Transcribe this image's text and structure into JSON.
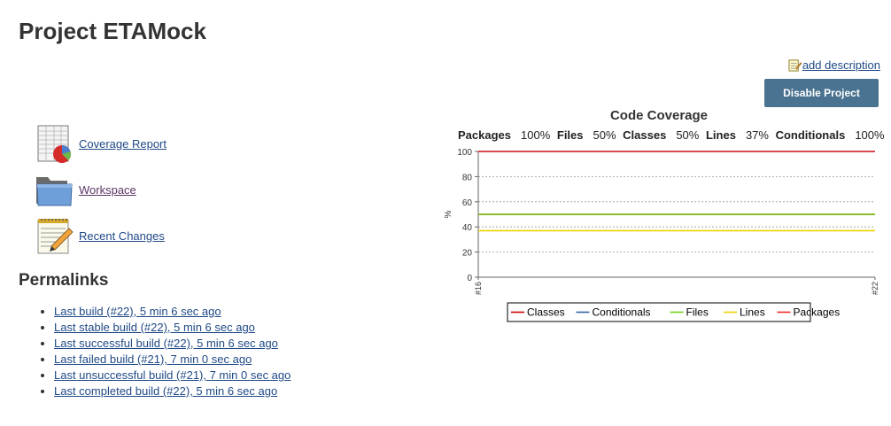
{
  "page": {
    "title": "Project ETAMock"
  },
  "actions": {
    "add_description": "add description",
    "disable_project": "Disable Project"
  },
  "tasks": [
    {
      "label": "Coverage Report",
      "icon": "coverage-report-icon"
    },
    {
      "label": "Workspace",
      "icon": "folder-icon"
    },
    {
      "label": "Recent Changes",
      "icon": "notepad-icon"
    }
  ],
  "permalinks": {
    "title": "Permalinks",
    "items": [
      "Last build (#22), 5 min 6 sec ago",
      "Last stable build (#22), 5 min 6 sec ago",
      "Last successful build (#22), 5 min 6 sec ago",
      "Last failed build (#21), 7 min 0 sec ago",
      "Last unsuccessful build (#21), 7 min 0 sec ago",
      "Last completed build (#22), 5 min 6 sec ago"
    ]
  },
  "coverage_summary": [
    {
      "label": "Packages",
      "value": "100%"
    },
    {
      "label": "Files",
      "value": "50%"
    },
    {
      "label": "Classes",
      "value": "50%"
    },
    {
      "label": "Lines",
      "value": "37%"
    },
    {
      "label": "Conditionals",
      "value": "100%"
    }
  ],
  "chart_data": {
    "type": "line",
    "title": "Code Coverage",
    "xlabel": "",
    "ylabel": "%",
    "x": [
      "#16",
      "#22"
    ],
    "ylim": [
      0,
      100
    ],
    "yticks": [
      0,
      20,
      40,
      60,
      80,
      100
    ],
    "grid": true,
    "legend_position": "bottom",
    "series": [
      {
        "name": "Classes",
        "color": "#cc0000",
        "values": [
          50,
          50
        ]
      },
      {
        "name": "Conditionals",
        "color": "#3465a4",
        "values": [
          100,
          100
        ]
      },
      {
        "name": "Files",
        "color": "#73d216",
        "values": [
          50,
          50
        ]
      },
      {
        "name": "Lines",
        "color": "#edd400",
        "values": [
          37,
          37
        ]
      },
      {
        "name": "Packages",
        "color": "#ef2929",
        "values": [
          100,
          100
        ]
      }
    ]
  }
}
